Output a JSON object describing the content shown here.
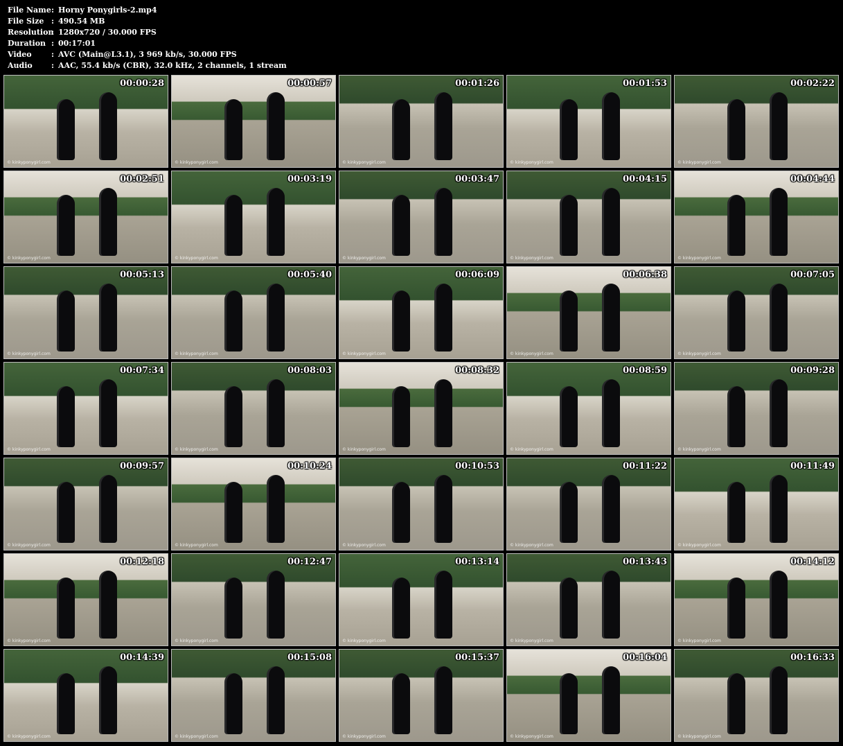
{
  "file_info": [
    {
      "label": "File Name",
      "value": "Horny Ponygirls-2.mp4"
    },
    {
      "label": "File Size",
      "value": "490.54 MB"
    },
    {
      "label": "Resolution",
      "value": "1280x720 / 30.000 FPS"
    },
    {
      "label": "Duration",
      "value": "00:17:01"
    },
    {
      "label": "Video",
      "value": "AVC (Main@L3.1), 3 969 kb/s, 30.000 FPS"
    },
    {
      "label": "Audio",
      "value": "AAC, 55.4 kb/s (CBR), 32.0 kHz, 2 channels, 1 stream"
    }
  ],
  "separator": ":",
  "watermark": "© kinkyponygirl.com",
  "thumbnails": [
    "00:00:28",
    "00:00:57",
    "00:01:26",
    "00:01:53",
    "00:02:22",
    "00:02:51",
    "00:03:19",
    "00:03:47",
    "00:04:15",
    "00:04:44",
    "00:05:13",
    "00:05:40",
    "00:06:09",
    "00:06:38",
    "00:07:05",
    "00:07:34",
    "00:08:03",
    "00:08:32",
    "00:08:59",
    "00:09:28",
    "00:09:57",
    "00:10:24",
    "00:10:53",
    "00:11:22",
    "00:11:49",
    "00:12:18",
    "00:12:47",
    "00:13:14",
    "00:13:43",
    "00:14:12",
    "00:14:39",
    "00:15:08",
    "00:15:37",
    "00:16:04",
    "00:16:33"
  ]
}
